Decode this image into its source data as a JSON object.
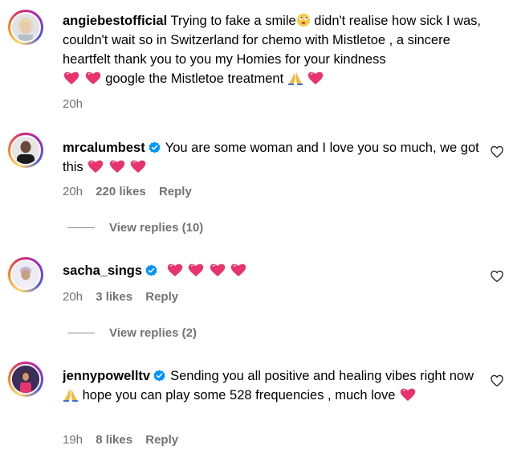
{
  "comments": [
    {
      "username": "angiebestofficial",
      "text_1": "Trying to fake a smile",
      "text_2": "didn't realise how sick I was, couldn't wait so in Switzerland for chemo with Mistletoe , a sincere heartfelt thank you to you my Homies for your kindness",
      "text_3": "google the Mistletoe treatment",
      "time": "20h",
      "verified": false
    },
    {
      "username": "mrcalumbest",
      "text_1": "You are some woman and I love you so much, we got this",
      "time": "20h",
      "likes": "220 likes",
      "reply": "Reply",
      "verified": true,
      "view_replies": "View replies (10)"
    },
    {
      "username": "sacha_sings",
      "time": "20h",
      "likes": "3 likes",
      "reply": "Reply",
      "verified": true,
      "view_replies": "View replies (2)"
    },
    {
      "username": "jennypowelltv",
      "text_1": "Sending you all positive and healing vibes right now",
      "text_2": "hope you can play some 528 frequencies , much love",
      "time": "19h",
      "likes": "8 likes",
      "reply": "Reply",
      "verified": true
    }
  ],
  "colors": {
    "heart_emoji": "#e8336d",
    "verified": "#0095f6",
    "meta_text": "#737373"
  }
}
